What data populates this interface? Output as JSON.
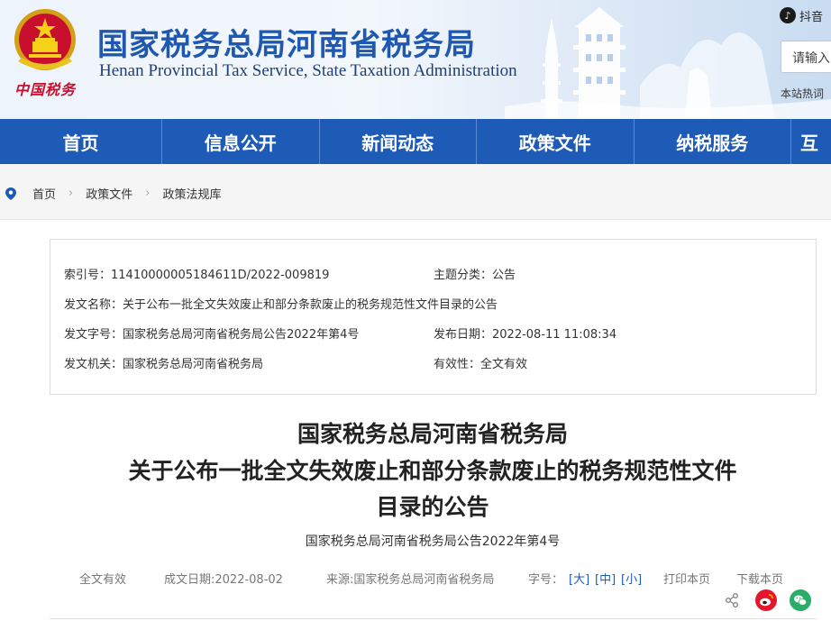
{
  "header": {
    "emblem_text": "中国税务",
    "site_title": "国家税务总局河南省税务局",
    "site_subtitle": "Henan Provincial Tax Service, State Taxation Administration",
    "douyin_label": "抖音",
    "search_placeholder": "请输入",
    "hot_words": "本站热词"
  },
  "nav": {
    "items": [
      "首页",
      "信息公开",
      "新闻动态",
      "政策文件",
      "纳税服务",
      "互"
    ]
  },
  "breadcrumb": {
    "items": [
      "首页",
      "政策文件",
      "政策法规库"
    ]
  },
  "meta": {
    "index_label": "索引号：",
    "index_value": "11410000005184611D/2022-009819",
    "topic_label": "主题分类：",
    "topic_value": "公告",
    "doc_name_label": "发文名称：",
    "doc_name_value": "关于公布一批全文失效废止和部分条款废止的税务规范性文件目录的公告",
    "doc_no_label": "发文字号：",
    "doc_no_value": "国家税务总局河南省税务局公告2022年第4号",
    "pub_date_label": "发布日期：",
    "pub_date_value": "2022-08-11 11:08:34",
    "issuer_label": "发文机关：",
    "issuer_value": "国家税务总局河南省税务局",
    "validity_label": "有效性：",
    "validity_value": "全文有效"
  },
  "article": {
    "title_line1": "国家税务总局河南省税务局",
    "title_line2": "关于公布一批全文失效废止和部分条款废止的税务规范性文件",
    "title_line3": "目录的公告",
    "doc_number": "国家税务总局河南省税务局公告2022年第4号",
    "validity": "全文有效",
    "date": "成文日期:2022-08-02",
    "source": "来源:国家税务总局河南省税务局",
    "font_size_label": "字号：",
    "font_large": "[大]",
    "font_medium": "[中]",
    "font_small": "[小]",
    "print": "打印本页",
    "download": "下载本页"
  },
  "colors": {
    "nav_bg": "#1e5bb6",
    "title_blue": "#1f58b0",
    "emblem_red": "#c8102e",
    "weibo_red": "#e6162d",
    "wechat_green": "#2aae67"
  }
}
